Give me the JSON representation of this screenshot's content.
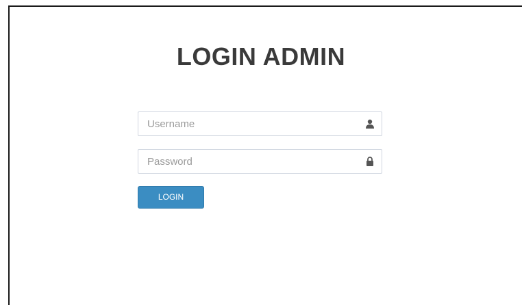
{
  "page": {
    "title": "LOGIN ADMIN"
  },
  "form": {
    "username": {
      "placeholder": "Username",
      "value": "",
      "icon": "user-icon"
    },
    "password": {
      "placeholder": "Password",
      "value": "",
      "icon": "lock-icon"
    },
    "submit_label": "LOGIN"
  },
  "colors": {
    "title": "#3a3a3a",
    "button": "#3b8dc2",
    "button_text": "#ffffff",
    "input_border": "#cfd5df",
    "icon": "#555555"
  }
}
